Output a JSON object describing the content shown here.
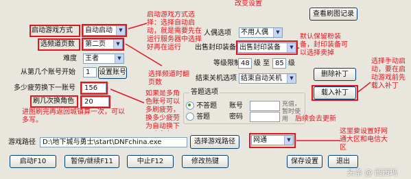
{
  "title_snippet": "改变设置",
  "settings": {
    "start_mode_label": "启动游戏方式",
    "start_mode_value": "自动启动",
    "channel_page_label": "选频道页数",
    "channel_page_value": "第二页",
    "difficulty_label": "难度",
    "difficulty_value": "王者",
    "account_start_label": "从第几个账号开始",
    "account_start_value": "1",
    "set_account_button": "设置账号",
    "fatigue_label": "多少疲劳换下一账号",
    "fatigue_value": "156",
    "roles_label": "刷几次换角色",
    "roles_value": "20",
    "partner_label": "人偶选项",
    "partner_value": "不用人偶",
    "sell_label": "出售封印装备",
    "sell_value": "出售封印装备",
    "level_limit_label": "等级限制",
    "level_min": "48",
    "level_to": "级 至",
    "level_max": "85",
    "level_unit": "级",
    "shutdown_label": "结束关机选项",
    "shutdown_value": "结束自动关机"
  },
  "answer_group": {
    "title": "答题选项",
    "no_answer": "不答题",
    "answer": "答题",
    "account_label": "账号",
    "password_label": "密码",
    "note": "充值，暂时使用"
  },
  "path": {
    "label": "游戏路径",
    "value": "D:\\地下城与勇士\\start\\DNFchina.exe",
    "choose_button": "选择游戏路径",
    "network_value": "网通"
  },
  "buttons": {
    "view_log": "查看刷图记录",
    "delete_patch": "删除补丁",
    "load_patch": "载入补丁",
    "start": "启动F10",
    "pause": "暂停/继续F11",
    "stop": "中止F12",
    "hotkey": "修改热键",
    "save": "保存设置",
    "exit": "退出"
  },
  "annotations": {
    "a1": "启动游戏方式选择：选择自动启动，就是需要先在运行服务器中选择好再在运行",
    "a2": "选择频道时翻页数",
    "a3": "默认保留粉装备，封印装备可以选择卖掉",
    "a4": "选择手动启动，要在启动游戏前先载入补丁",
    "a5": "如果是多角色账号可以多刷疲劳，换多少疲劳为自动换下一个角色",
    "a6": "进图刷完再返回城镇算一次，可以多写。",
    "a7": "这里要设置好网通大区和电信大区",
    "a8": "后续会去更新"
  },
  "watermark": "头条 @ 西西玛"
}
